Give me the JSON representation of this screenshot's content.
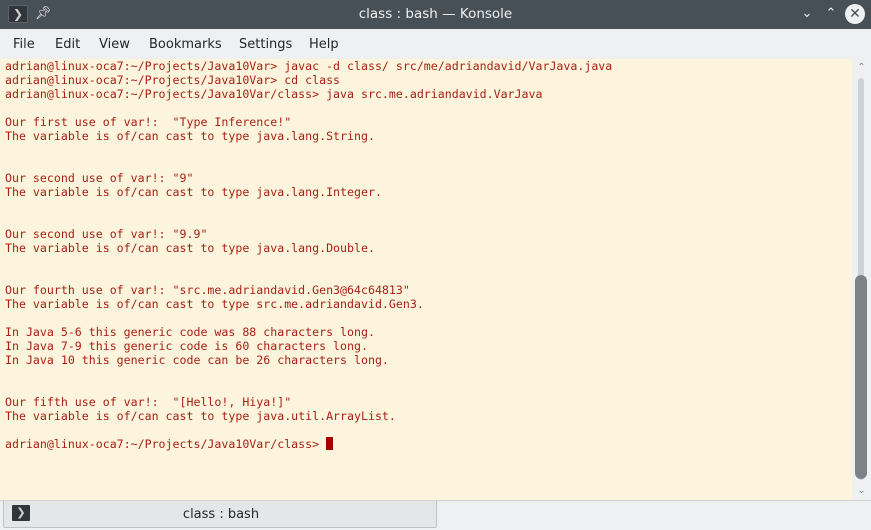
{
  "window": {
    "title": "class : bash — Konsole",
    "app_icon": "terminal-icon",
    "pin_icon": "pin-icon",
    "minimize_glyph": "⌄",
    "maximize_glyph": "⌃",
    "close_glyph": "✕"
  },
  "menu": {
    "items": [
      "File",
      "Edit",
      "View",
      "Bookmarks",
      "Settings",
      "Help"
    ]
  },
  "terminal": {
    "lines": [
      "adrian@linux-oca7:~/Projects/Java10Var> javac -d class/ src/me/adriandavid/VarJava.java",
      "adrian@linux-oca7:~/Projects/Java10Var> cd class",
      "adrian@linux-oca7:~/Projects/Java10Var/class> java src.me.adriandavid.VarJava",
      "",
      "Our first use of var!:  \"Type Inference!\"",
      "The variable is of/can cast to type java.lang.String.",
      "",
      "",
      "Our second use of var!: \"9\"",
      "The variable is of/can cast to type java.lang.Integer.",
      "",
      "",
      "Our second use of var!: \"9.9\"",
      "The variable is of/can cast to type java.lang.Double.",
      "",
      "",
      "Our fourth use of var!: \"src.me.adriandavid.Gen3@64c64813\"",
      "The variable is of/can cast to type src.me.adriandavid.Gen3.",
      "",
      "In Java 5-6 this generic code was 88 characters long.",
      "In Java 7-9 this generic code is 60 characters long.",
      "In Java 10 this generic code can be 26 characters long.",
      "",
      "",
      "Our fifth use of var!:  \"[Hello!, Hiya!]\"",
      "The variable is of/can cast to type java.util.ArrayList.",
      "",
      "adrian@linux-oca7:~/Projects/Java10Var/class> "
    ],
    "text_color": "#a82117",
    "background": "#fcf4dc",
    "cursor_color": "#a80000"
  },
  "scrollbar": {
    "position_fraction": 0.53,
    "visible_fraction": 0.5
  },
  "tabs": [
    {
      "label": "class : bash",
      "icon": "terminal-icon"
    }
  ]
}
